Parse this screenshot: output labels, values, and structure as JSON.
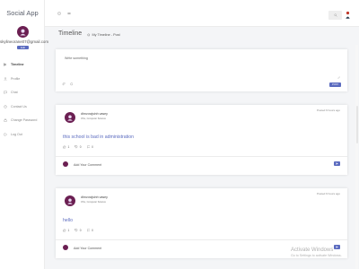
{
  "app": {
    "brand": "Social App"
  },
  "user": {
    "email": "skylineorane07@gmail.com",
    "edit_label": "Edit"
  },
  "sidebar": {
    "items": [
      {
        "label": "Timeline",
        "icon": "timeline-icon",
        "active": true
      },
      {
        "label": "Profile",
        "icon": "user-icon",
        "active": false
      },
      {
        "label": "Chat",
        "icon": "chat-icon",
        "active": false
      },
      {
        "label": "Contact Us",
        "icon": "contact-icon",
        "active": false
      },
      {
        "label": "Change Password",
        "icon": "lock-icon",
        "active": false
      },
      {
        "label": "Log Out",
        "icon": "logout-icon",
        "active": false
      }
    ]
  },
  "page": {
    "title": "Timeline",
    "breadcrumb": {
      "part1": "My Timeline",
      "separator": " - ",
      "part2": "Post"
    }
  },
  "composer": {
    "placeholder": "Write something",
    "post_label": "POST"
  },
  "posts": [
    {
      "author": "dhruvrajsinh vasey",
      "subtitle": "OSL, Computer Science",
      "time": "Posted 9 hours ago",
      "text": "this school is bad in administration",
      "likes": "1",
      "dislikes": "0",
      "comments": "0",
      "comment_placeholder": "Add Your Comment"
    },
    {
      "author": "dhruvrajsinh vasey",
      "subtitle": "OSL, Computer Science",
      "time": "Posted 9 hours ago",
      "text": "hello",
      "likes": "1",
      "dislikes": "0",
      "comments": "0",
      "comment_placeholder": "Add Your Comment"
    }
  ],
  "watermark": {
    "line1": "Activate Windows",
    "line2": "Go to Settings to activate Windows."
  },
  "colors": {
    "accent": "#5b6bbf",
    "avatar": "#6b1f52",
    "background": "#f4f5f7"
  }
}
